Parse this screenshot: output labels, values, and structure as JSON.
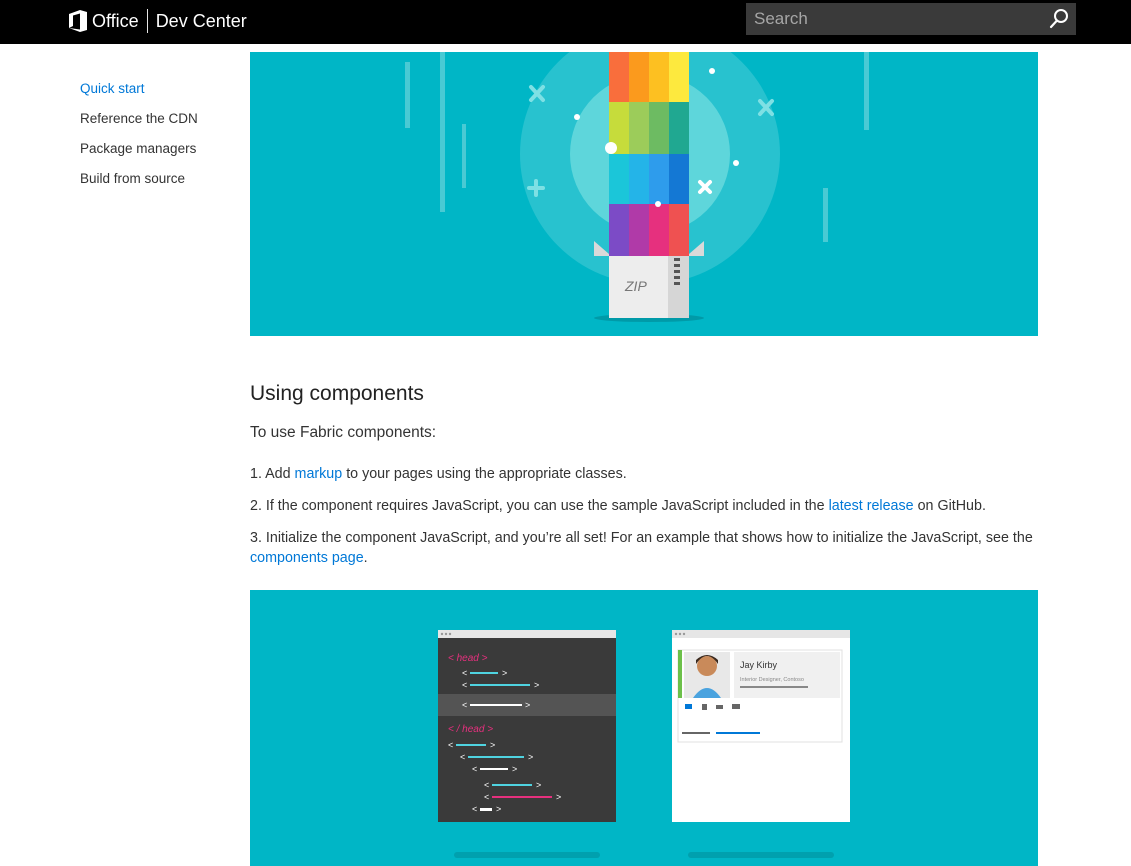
{
  "header": {
    "office_label": "Office",
    "dev_center_label": "Dev Center",
    "search_placeholder": "Search"
  },
  "sidebar": {
    "items": [
      {
        "label": "Quick start",
        "active": true
      },
      {
        "label": "Reference the CDN",
        "active": false
      },
      {
        "label": "Package managers",
        "active": false
      },
      {
        "label": "Build from source",
        "active": false
      }
    ]
  },
  "hero": {
    "zip_label": "ZIP"
  },
  "section": {
    "title": "Using components",
    "intro": "To use Fabric components:",
    "steps": [
      {
        "prefix": "1. Add ",
        "link": "markup",
        "suffix": " to your pages using the appropriate classes."
      },
      {
        "prefix": "2. If the component requires JavaScript, you can use the sample JavaScript included in the ",
        "link": "latest release",
        "suffix": " on GitHub."
      },
      {
        "prefix": "3. Initialize the component JavaScript, and you’re all set! For an example that shows how to initialize the JavaScript, see the ",
        "link": "components page",
        "suffix": "."
      }
    ]
  },
  "illustration": {
    "code_open_tag": "< head >",
    "code_close_tag": "< / head >",
    "persona_name": "Jay Kirby",
    "persona_title": "Interior Designer, Contoso"
  },
  "colors": {
    "accent": "#0078d7",
    "hero_bg": "#00b6c6",
    "header_bg": "#000000"
  }
}
